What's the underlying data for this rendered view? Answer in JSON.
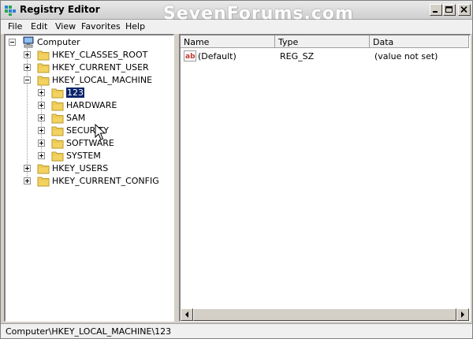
{
  "window": {
    "title": "Registry Editor",
    "watermark": "SevenForums.com"
  },
  "menu": [
    "File",
    "Edit",
    "View",
    "Favorites",
    "Help"
  ],
  "tree": {
    "root": "Computer",
    "hives": {
      "hkcr": "HKEY_CLASSES_ROOT",
      "hkcu": "HKEY_CURRENT_USER",
      "hklm": "HKEY_LOCAL_MACHINE",
      "hku": "HKEY_USERS",
      "hkcc": "HKEY_CURRENT_CONFIG"
    },
    "hklm_children": {
      "k123": "123",
      "hardware": "HARDWARE",
      "sam": "SAM",
      "security": "SECURITY",
      "software": "SOFTWARE",
      "system": "SYSTEM"
    },
    "selected": "123"
  },
  "list": {
    "columns": [
      "Name",
      "Type",
      "Data"
    ],
    "rows": [
      {
        "name": "(Default)",
        "type": "REG_SZ",
        "data": "(value not set)"
      }
    ]
  },
  "status": {
    "path": "Computer\\HKEY_LOCAL_MACHINE\\123"
  },
  "colors": {
    "selection": "#0a246a",
    "folder": "#f3d25f",
    "window": "#d4d0c8"
  },
  "icons": [
    "regedit-icon",
    "computer-icon",
    "folder-icon",
    "string-value-icon",
    "minimize-icon",
    "maximize-icon",
    "close-icon",
    "arrow-left-icon",
    "arrow-right-icon",
    "mouse-cursor-icon"
  ]
}
